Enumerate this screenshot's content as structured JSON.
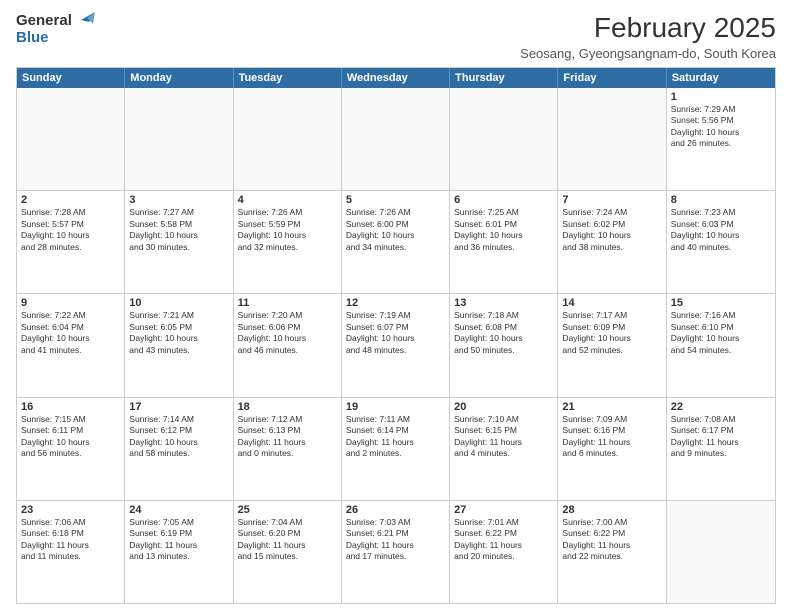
{
  "logo": {
    "general": "General",
    "blue": "Blue"
  },
  "title": {
    "month_year": "February 2025",
    "location": "Seosang, Gyeongsangnam-do, South Korea"
  },
  "calendar": {
    "headers": [
      "Sunday",
      "Monday",
      "Tuesday",
      "Wednesday",
      "Thursday",
      "Friday",
      "Saturday"
    ],
    "rows": [
      [
        {
          "day": "",
          "info": ""
        },
        {
          "day": "",
          "info": ""
        },
        {
          "day": "",
          "info": ""
        },
        {
          "day": "",
          "info": ""
        },
        {
          "day": "",
          "info": ""
        },
        {
          "day": "",
          "info": ""
        },
        {
          "day": "1",
          "info": "Sunrise: 7:29 AM\nSunset: 5:56 PM\nDaylight: 10 hours\nand 26 minutes."
        }
      ],
      [
        {
          "day": "2",
          "info": "Sunrise: 7:28 AM\nSunset: 5:57 PM\nDaylight: 10 hours\nand 28 minutes."
        },
        {
          "day": "3",
          "info": "Sunrise: 7:27 AM\nSunset: 5:58 PM\nDaylight: 10 hours\nand 30 minutes."
        },
        {
          "day": "4",
          "info": "Sunrise: 7:26 AM\nSunset: 5:59 PM\nDaylight: 10 hours\nand 32 minutes."
        },
        {
          "day": "5",
          "info": "Sunrise: 7:26 AM\nSunset: 6:00 PM\nDaylight: 10 hours\nand 34 minutes."
        },
        {
          "day": "6",
          "info": "Sunrise: 7:25 AM\nSunset: 6:01 PM\nDaylight: 10 hours\nand 36 minutes."
        },
        {
          "day": "7",
          "info": "Sunrise: 7:24 AM\nSunset: 6:02 PM\nDaylight: 10 hours\nand 38 minutes."
        },
        {
          "day": "8",
          "info": "Sunrise: 7:23 AM\nSunset: 6:03 PM\nDaylight: 10 hours\nand 40 minutes."
        }
      ],
      [
        {
          "day": "9",
          "info": "Sunrise: 7:22 AM\nSunset: 6:04 PM\nDaylight: 10 hours\nand 41 minutes."
        },
        {
          "day": "10",
          "info": "Sunrise: 7:21 AM\nSunset: 6:05 PM\nDaylight: 10 hours\nand 43 minutes."
        },
        {
          "day": "11",
          "info": "Sunrise: 7:20 AM\nSunset: 6:06 PM\nDaylight: 10 hours\nand 46 minutes."
        },
        {
          "day": "12",
          "info": "Sunrise: 7:19 AM\nSunset: 6:07 PM\nDaylight: 10 hours\nand 48 minutes."
        },
        {
          "day": "13",
          "info": "Sunrise: 7:18 AM\nSunset: 6:08 PM\nDaylight: 10 hours\nand 50 minutes."
        },
        {
          "day": "14",
          "info": "Sunrise: 7:17 AM\nSunset: 6:09 PM\nDaylight: 10 hours\nand 52 minutes."
        },
        {
          "day": "15",
          "info": "Sunrise: 7:16 AM\nSunset: 6:10 PM\nDaylight: 10 hours\nand 54 minutes."
        }
      ],
      [
        {
          "day": "16",
          "info": "Sunrise: 7:15 AM\nSunset: 6:11 PM\nDaylight: 10 hours\nand 56 minutes."
        },
        {
          "day": "17",
          "info": "Sunrise: 7:14 AM\nSunset: 6:12 PM\nDaylight: 10 hours\nand 58 minutes."
        },
        {
          "day": "18",
          "info": "Sunrise: 7:12 AM\nSunset: 6:13 PM\nDaylight: 11 hours\nand 0 minutes."
        },
        {
          "day": "19",
          "info": "Sunrise: 7:11 AM\nSunset: 6:14 PM\nDaylight: 11 hours\nand 2 minutes."
        },
        {
          "day": "20",
          "info": "Sunrise: 7:10 AM\nSunset: 6:15 PM\nDaylight: 11 hours\nand 4 minutes."
        },
        {
          "day": "21",
          "info": "Sunrise: 7:09 AM\nSunset: 6:16 PM\nDaylight: 11 hours\nand 6 minutes."
        },
        {
          "day": "22",
          "info": "Sunrise: 7:08 AM\nSunset: 6:17 PM\nDaylight: 11 hours\nand 9 minutes."
        }
      ],
      [
        {
          "day": "23",
          "info": "Sunrise: 7:06 AM\nSunset: 6:18 PM\nDaylight: 11 hours\nand 11 minutes."
        },
        {
          "day": "24",
          "info": "Sunrise: 7:05 AM\nSunset: 6:19 PM\nDaylight: 11 hours\nand 13 minutes."
        },
        {
          "day": "25",
          "info": "Sunrise: 7:04 AM\nSunset: 6:20 PM\nDaylight: 11 hours\nand 15 minutes."
        },
        {
          "day": "26",
          "info": "Sunrise: 7:03 AM\nSunset: 6:21 PM\nDaylight: 11 hours\nand 17 minutes."
        },
        {
          "day": "27",
          "info": "Sunrise: 7:01 AM\nSunset: 6:22 PM\nDaylight: 11 hours\nand 20 minutes."
        },
        {
          "day": "28",
          "info": "Sunrise: 7:00 AM\nSunset: 6:22 PM\nDaylight: 11 hours\nand 22 minutes."
        },
        {
          "day": "",
          "info": ""
        }
      ]
    ]
  }
}
